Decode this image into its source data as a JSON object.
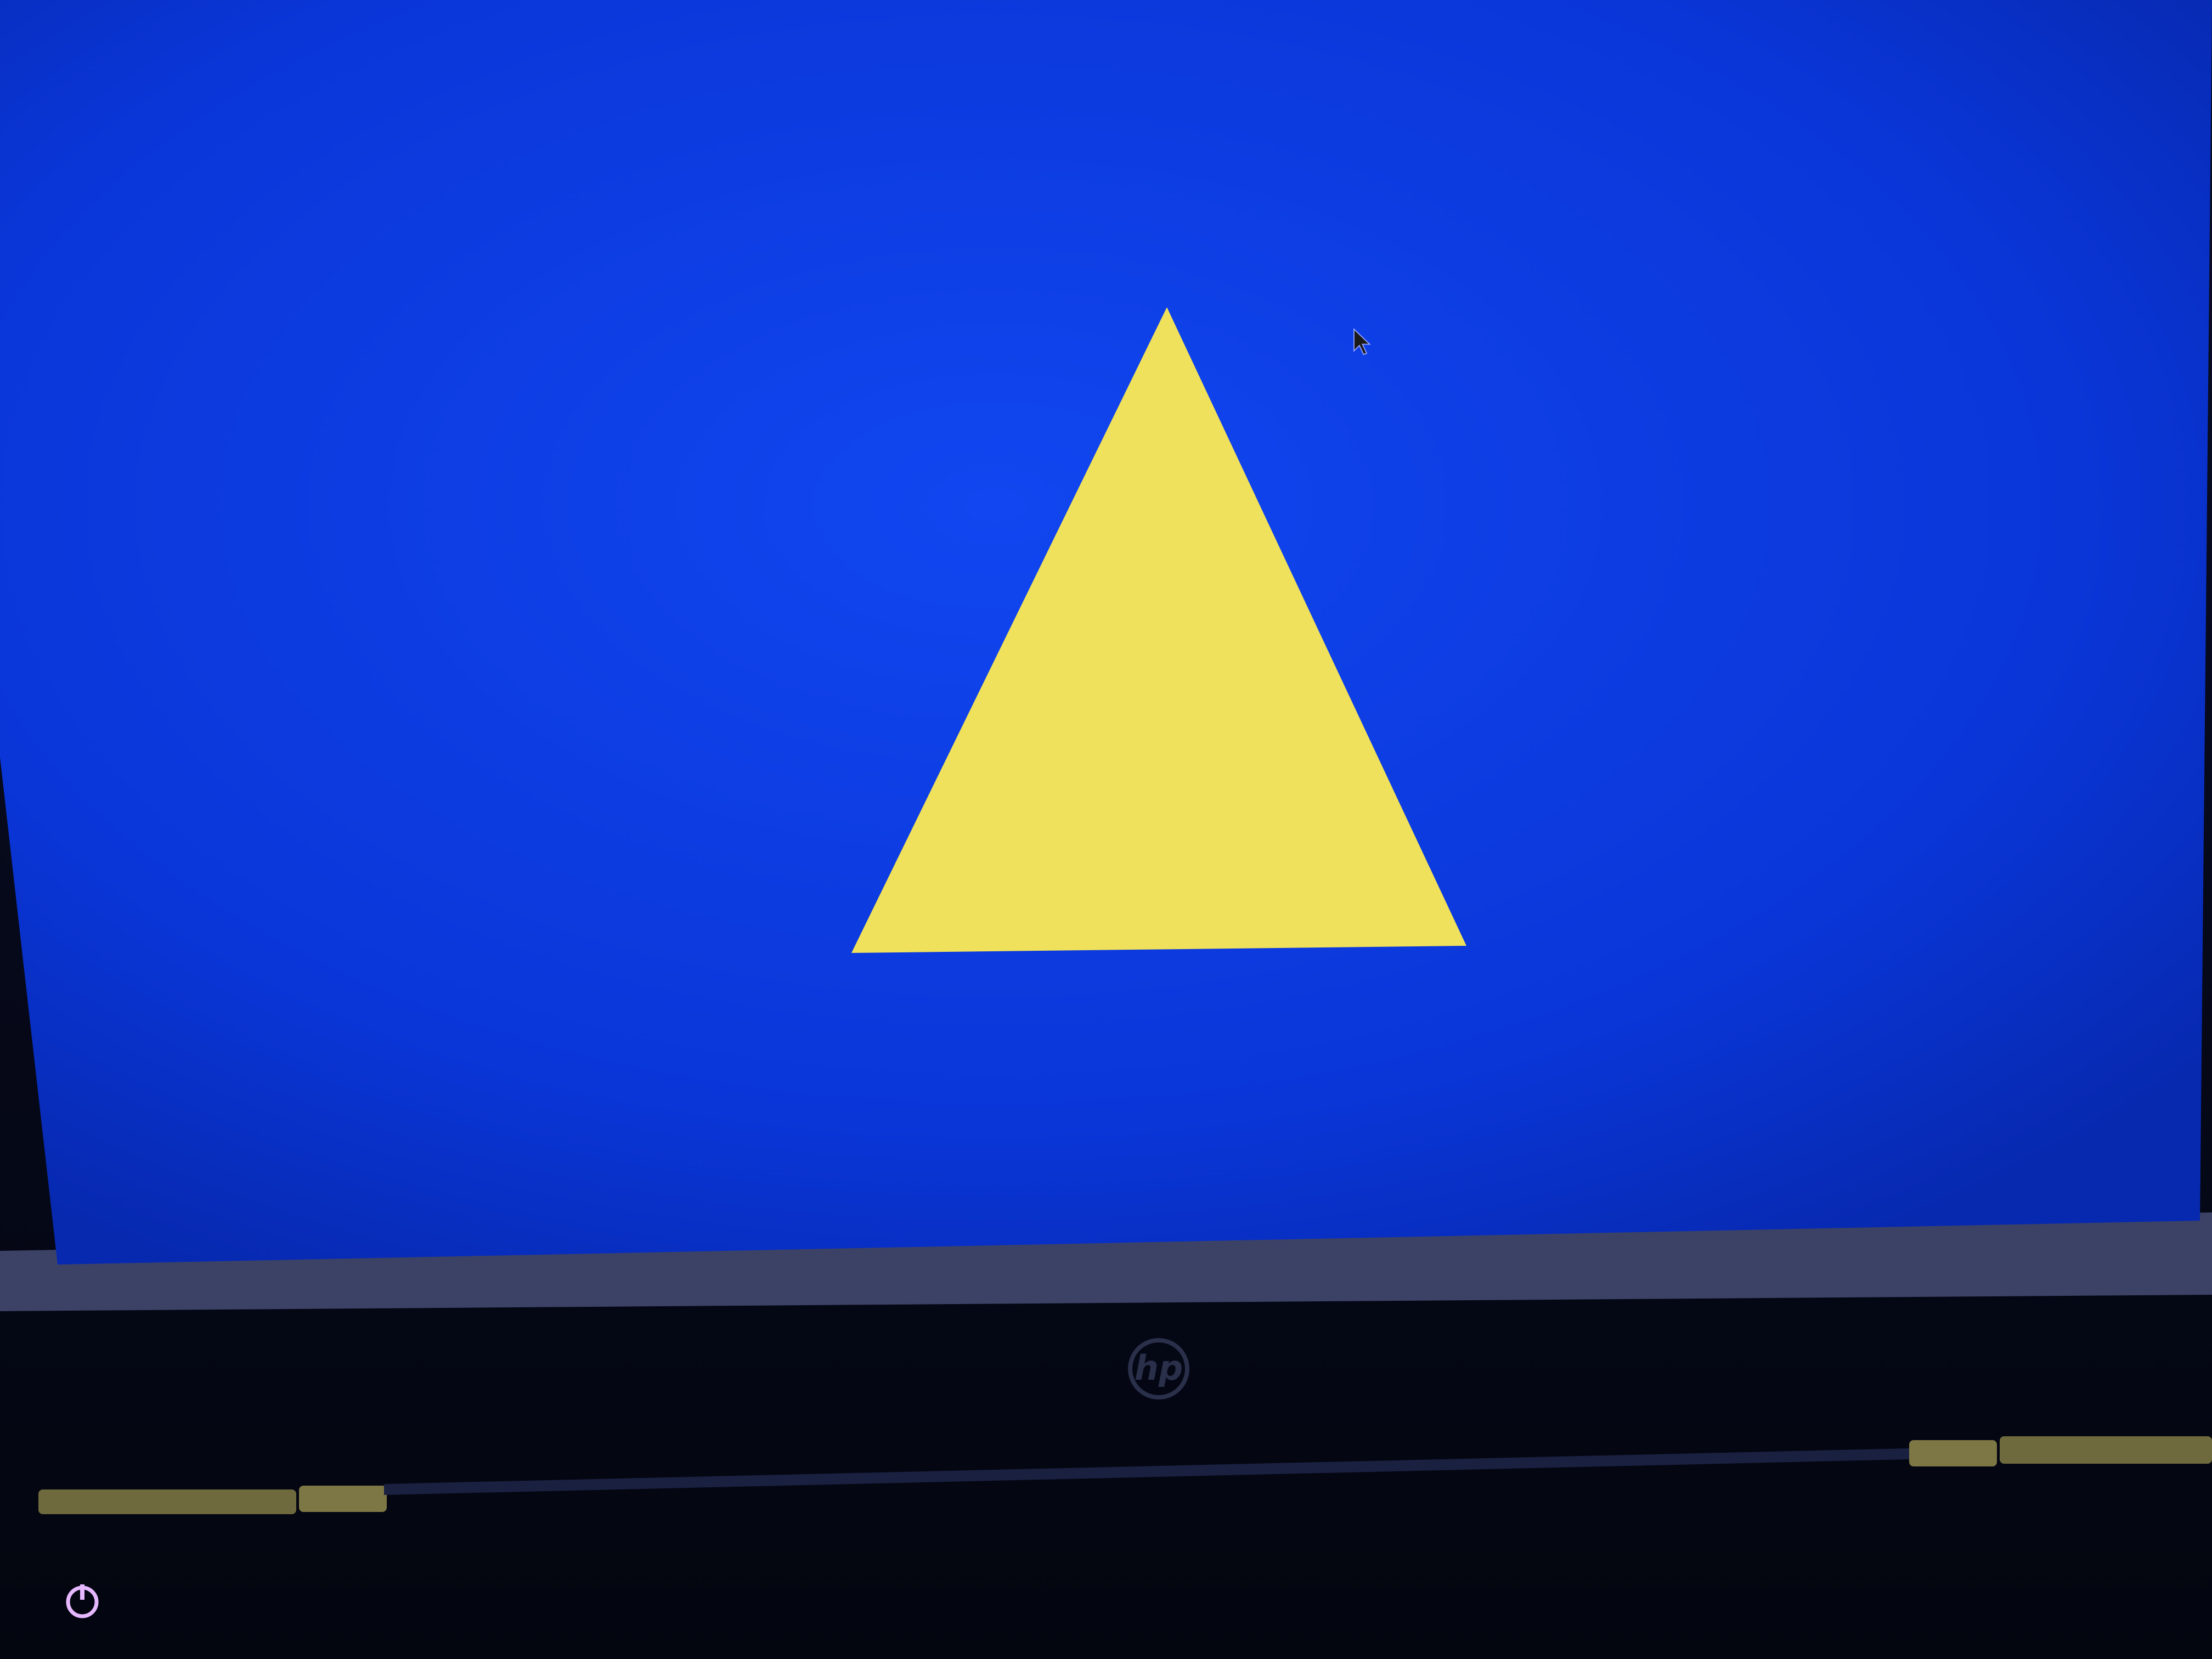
{
  "screen": {
    "background_color": "#0a3ae6",
    "shape": "triangle",
    "shape_color": "#efe15c"
  },
  "cursor": {
    "icon": "arrow-cursor-icon",
    "color": "#1a1a1a"
  },
  "laptop": {
    "brand_logo_text": "hp",
    "logo_color": "#2a2f4a",
    "bezel_color": "#4a4f6e",
    "body_color": "#070b22",
    "hinge_color": "#8a8450"
  },
  "power_indicator": {
    "icon": "power-icon",
    "color": "#e6b8ff"
  }
}
